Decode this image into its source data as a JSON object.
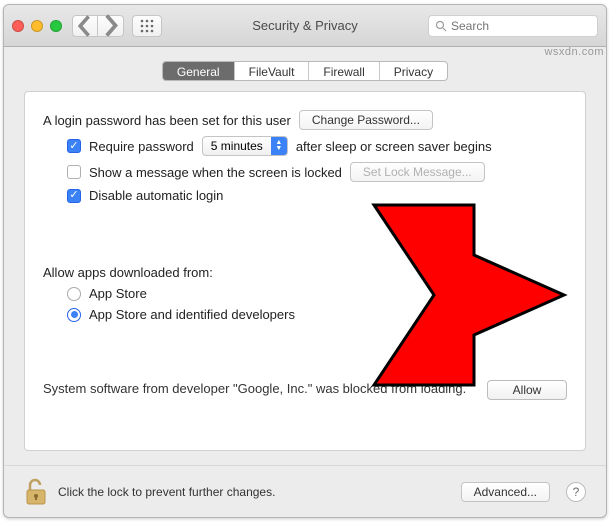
{
  "window": {
    "title": "Security & Privacy",
    "search_placeholder": "Search"
  },
  "tabs": {
    "general": "General",
    "filevault": "FileVault",
    "firewall": "Firewall",
    "privacy": "Privacy"
  },
  "login": {
    "password_set_text": "A login password has been set for this user",
    "change_password_btn": "Change Password...",
    "require_password_label": "Require password",
    "require_password_delay": "5 minutes",
    "require_password_after": "after sleep or screen saver begins",
    "show_message_label": "Show a message when the screen is locked",
    "set_lock_message_btn": "Set Lock Message...",
    "disable_autologin_label": "Disable automatic login"
  },
  "downloaded": {
    "heading": "Allow apps downloaded from:",
    "opt_appstore": "App Store",
    "opt_identified": "App Store and identified developers"
  },
  "blocked": {
    "message": "System software from developer \"Google, Inc.\" was blocked from loading.",
    "allow_btn": "Allow"
  },
  "footer": {
    "lock_text": "Click the lock to prevent further changes.",
    "advanced_btn": "Advanced..."
  },
  "watermark": "wsxdn.com"
}
